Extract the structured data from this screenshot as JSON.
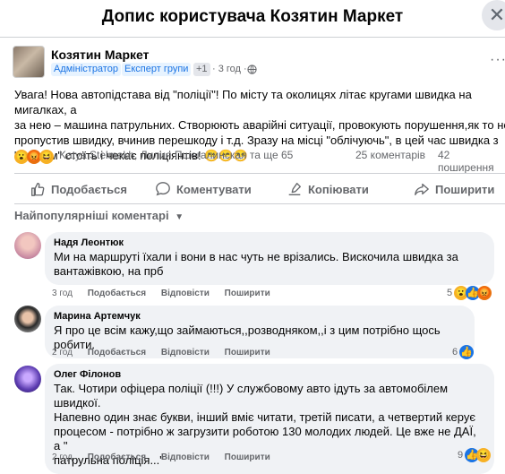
{
  "header": {
    "title": "Допис користувача Козятин Маркет",
    "close": "✕"
  },
  "post": {
    "author": "Козятин Маркет",
    "badges": [
      "Адміністратор",
      "Експерт групи",
      "+1"
    ],
    "time": "· 3 год ·",
    "more": "···",
    "text_lines": [
      "Увага! Нова автопідстава від \"поліції\"! По місту та околицях літає кругами швидка на мигалках, а",
      "за нею –  машина патрульних. Створюють аварійні ситуації, провокують порушення,як то не",
      "пропустив швидку, вчинив перешкоду і т.д. Зразу на місці \"облічуючь\", в цей час швидка з",
      "\"хворим\" стоїть і чекає поліціянтів! 😁😁😁"
    ],
    "reactions_text": "Katya Stelmakh, Лилия Пшегалинская та ще 65",
    "comments_count": "25 коментарів",
    "shares_count": "42 поширення"
  },
  "actions": {
    "like": "Подобається",
    "comment": "Коментувати",
    "copy": "Копіювати",
    "share": "Поширити"
  },
  "sort_label": "Найпопулярніші коментарі",
  "comments": [
    {
      "name": "Надя Леонтюк",
      "text_lines": [
        "Ми на маршруті їхали і вони в нас чуть не врізались. Вискочила швидка за",
        "вантажівкою, на прб"
      ],
      "time": "3 год",
      "like": "Подобається",
      "reply": "Відповісти",
      "share": "Поширити",
      "react_count": "5"
    },
    {
      "name": "Марина Артемчук",
      "text_lines": [
        "Я про це всім кажу,що займаються,,розводняком,,і з цим потрібно щось робити."
      ],
      "time": "2 год",
      "like": "Подобається",
      "reply": "Відповісти",
      "share": "Поширити",
      "react_count": "6"
    },
    {
      "name": "Олег Філонов",
      "text_lines": [
        "Так. Чотири офіцера поліції (!!!) У службовому авто ідуть за автомобілем швидкої.",
        "Напевно один знає букви, інший вміє читати, третій писати, а четвертий керує",
        "процесом - потрібно ж загрузити роботою 130 молодих людей. Це вже не ДАЇ, а \"",
        "патрульна поліція...\""
      ],
      "time": "2 год",
      "like": "Подобається",
      "reply": "Відповісти",
      "share": "Поширити",
      "react_count": "9"
    }
  ],
  "colors": {
    "accent": "#1b74e4",
    "bubble": "#f0f2f5",
    "muted": "#65676b"
  }
}
